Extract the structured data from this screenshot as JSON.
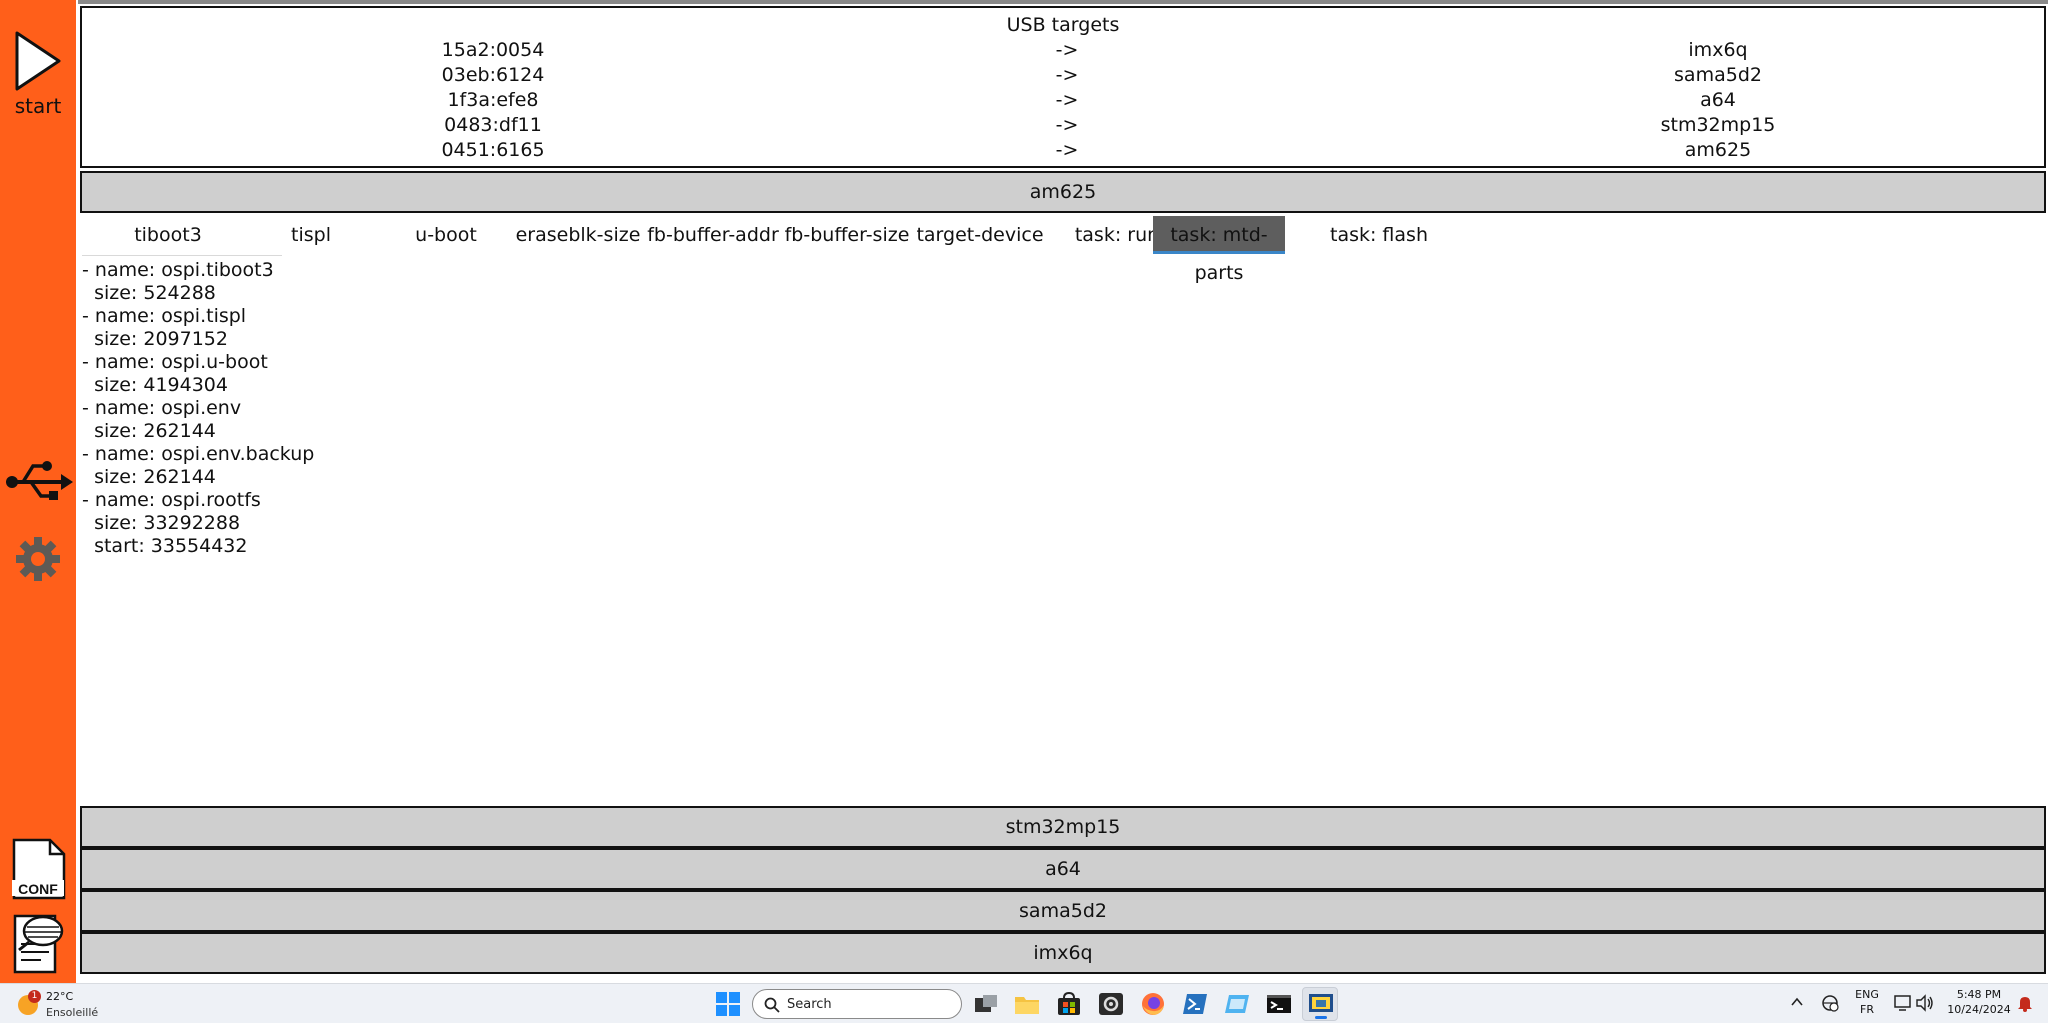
{
  "sidebar": {
    "start_label": "start",
    "conf_label": "CONF"
  },
  "usb_targets": {
    "title": "USB targets",
    "rows": [
      {
        "id": "15a2:0054",
        "arrow": "->",
        "name": "imx6q"
      },
      {
        "id": "03eb:6124",
        "arrow": "->",
        "name": "sama5d2"
      },
      {
        "id": "1f3a:efe8",
        "arrow": "->",
        "name": "a64"
      },
      {
        "id": "0483:df11",
        "arrow": "->",
        "name": "stm32mp15"
      },
      {
        "id": "0451:6165",
        "arrow": "->",
        "name": "am625"
      }
    ]
  },
  "expanded_device": "am625",
  "tabs": [
    {
      "label": "tiboot3"
    },
    {
      "label": "tispl"
    },
    {
      "label": "u-boot"
    },
    {
      "label": "eraseblk-size"
    },
    {
      "label": "fb-buffer-addr"
    },
    {
      "label": "fb-buffer-size"
    },
    {
      "label": "target-device"
    },
    {
      "label": "task: run"
    },
    {
      "label": "task: mtd-parts"
    },
    {
      "label": "task: flash"
    }
  ],
  "active_tab": "task: mtd-parts",
  "content_lines": [
    "- name: ospi.tiboot3",
    "  size: 524288",
    "- name: ospi.tispl",
    "  size: 2097152",
    "- name: ospi.u-boot",
    "  size: 4194304",
    "- name: ospi.env",
    "  size: 262144",
    "- name: ospi.env.backup",
    "  size: 262144",
    "- name: ospi.rootfs",
    "  size: 33292288",
    "  start: 33554432"
  ],
  "collapsed_devices": [
    "stm32mp15",
    "a64",
    "sama5d2",
    "imx6q"
  ],
  "taskbar": {
    "weather_temp": "22°C",
    "weather_condition": "Ensoleillé",
    "weather_badge": "1",
    "search_placeholder": "Search",
    "lang_top": "ENG",
    "lang_bottom": "FR",
    "time": "5:48 PM",
    "date": "10/24/2024"
  },
  "colors": {
    "sidebar": "#ff5f1a",
    "device_bar": "#cfcfcf",
    "active_tab": "#5e5e5e"
  }
}
